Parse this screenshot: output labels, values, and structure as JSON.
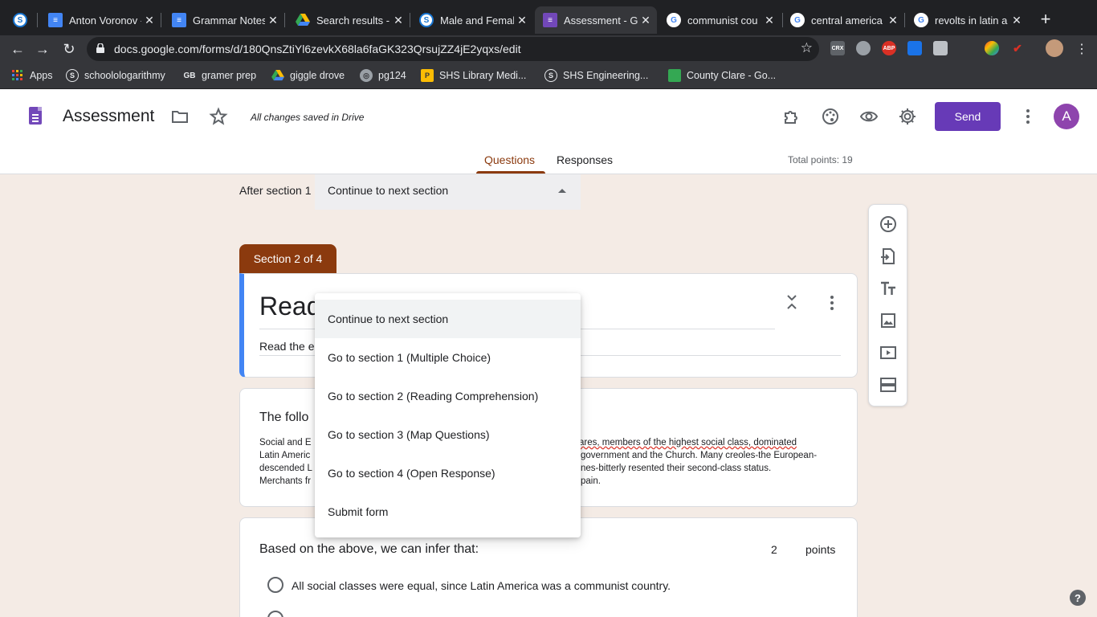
{
  "browser": {
    "tabs": [
      {
        "title": "Anton Voronov -",
        "icon": "schoology-icon"
      },
      {
        "title": "Grammar Notes",
        "icon": "google-docs-icon"
      },
      {
        "title": "Search results -",
        "icon": "google-drive-icon"
      },
      {
        "title": "Male and Femal",
        "icon": "schoology-icon"
      },
      {
        "title": "Assessment - G",
        "icon": "google-forms-icon"
      },
      {
        "title": "communist cou",
        "icon": "google-icon"
      },
      {
        "title": "central america",
        "icon": "google-icon"
      },
      {
        "title": "revolts in latin a",
        "icon": "google-icon"
      }
    ],
    "url": "docs.google.com/forms/d/180QnsZtiYl6zevkX68la6faGK323QrsujZZ4jE2yqxs/edit",
    "extensions": [
      "CRX",
      "ABP"
    ],
    "bookmarks": [
      {
        "label": "Apps"
      },
      {
        "label": "schoolologarithmy"
      },
      {
        "label": "gramer prep"
      },
      {
        "label": "giggle drove"
      },
      {
        "label": "pg124"
      },
      {
        "label": "SHS Library Medi..."
      },
      {
        "label": "SHS Engineering..."
      },
      {
        "label": "County Clare - Go..."
      }
    ]
  },
  "form_header": {
    "title": "Assessment",
    "save_status": "All changes saved in Drive",
    "send_label": "Send",
    "avatar_initial": "A",
    "tabs": {
      "questions": "Questions",
      "responses": "Responses"
    },
    "total_points": "Total points: 19"
  },
  "after_section": {
    "label": "After section 1",
    "value": "Continue to next section"
  },
  "section2": {
    "tag": "Section 2 of 4",
    "title": "Read",
    "description": "Read the e"
  },
  "passage_card": {
    "title": "The follo",
    "lines": {
      "l1_left": "Social and E",
      "l1_right": "ares, members of the highest social class, dominated",
      "l2_left": "Latin Americ",
      "l2_right": "government and the Church. Many creoles-the European-",
      "l3_left": "descended L",
      "l3_right": "nes-bitterly resented their second-class status.",
      "l4_left": "Merchants fr",
      "l4_right": "pain."
    }
  },
  "question_card": {
    "question": "Based on the above, we can infer that:",
    "points_value": "2",
    "points_label": "points",
    "options": [
      "All social classes were equal, since Latin America was a communist country."
    ]
  },
  "dropdown_menu": {
    "items": [
      "Continue to next section",
      "Go to section 1 (Multiple Choice)",
      "Go to section 2 (Reading Comprehension)",
      "Go to section 3 (Map Questions)",
      "Go to section 4 (Open Response)",
      "Submit form"
    ],
    "selected": "Continue to next section"
  },
  "colors": {
    "theme_accent": "#8b3a0e",
    "background": "#f4ebe5",
    "send_button": "#673ab7",
    "section_left_border": "#4285f4"
  }
}
